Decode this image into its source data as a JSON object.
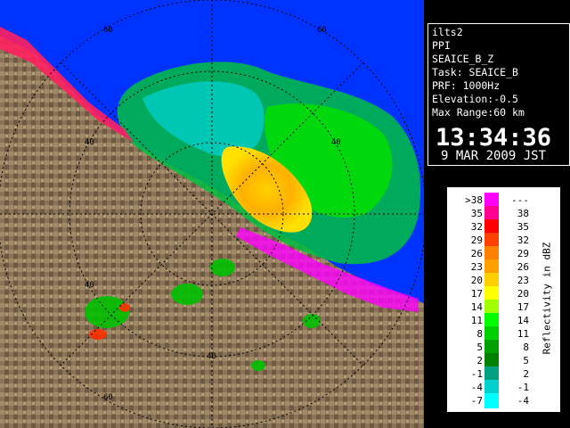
{
  "radar_view": {
    "range_labels": [
      "60",
      "60",
      "40",
      "40",
      "40",
      "40",
      "60"
    ]
  },
  "info_panel": {
    "station": "ilts2",
    "mode": "PPI",
    "product": "SEAICE_B_Z",
    "task": "Task: SEAICE_B",
    "prf": "PRF: 1000Hz",
    "elevation": "Elevation:-0.5",
    "max_range": "Max Range:60 km",
    "time": "13:34:36",
    "date": "9 MAR 2009 JST"
  },
  "legend": {
    "title": "Reflectivity in dBZ",
    "rows": [
      {
        "lo": ">38",
        "hi": "---",
        "color": "#ff00ff"
      },
      {
        "lo": "35",
        "hi": "38",
        "color": "#ff0090"
      },
      {
        "lo": "32",
        "hi": "35",
        "color": "#ff0000"
      },
      {
        "lo": "29",
        "hi": "32",
        "color": "#ff4000"
      },
      {
        "lo": "26",
        "hi": "29",
        "color": "#ff8000"
      },
      {
        "lo": "23",
        "hi": "26",
        "color": "#ffa000"
      },
      {
        "lo": "20",
        "hi": "23",
        "color": "#ffd000"
      },
      {
        "lo": "17",
        "hi": "20",
        "color": "#ffff00"
      },
      {
        "lo": "14",
        "hi": "17",
        "color": "#a0ff00"
      },
      {
        "lo": "11",
        "hi": "14",
        "color": "#00ff00"
      },
      {
        "lo": "8",
        "hi": "11",
        "color": "#00d000"
      },
      {
        "lo": "5",
        "hi": "8",
        "color": "#00a000"
      },
      {
        "lo": "2",
        "hi": "5",
        "color": "#008000"
      },
      {
        "lo": "-1",
        "hi": "2",
        "color": "#00a080"
      },
      {
        "lo": "-4",
        "hi": "-1",
        "color": "#00d0d0"
      },
      {
        "lo": "-7",
        "hi": "-4",
        "color": "#00ffff"
      }
    ]
  }
}
